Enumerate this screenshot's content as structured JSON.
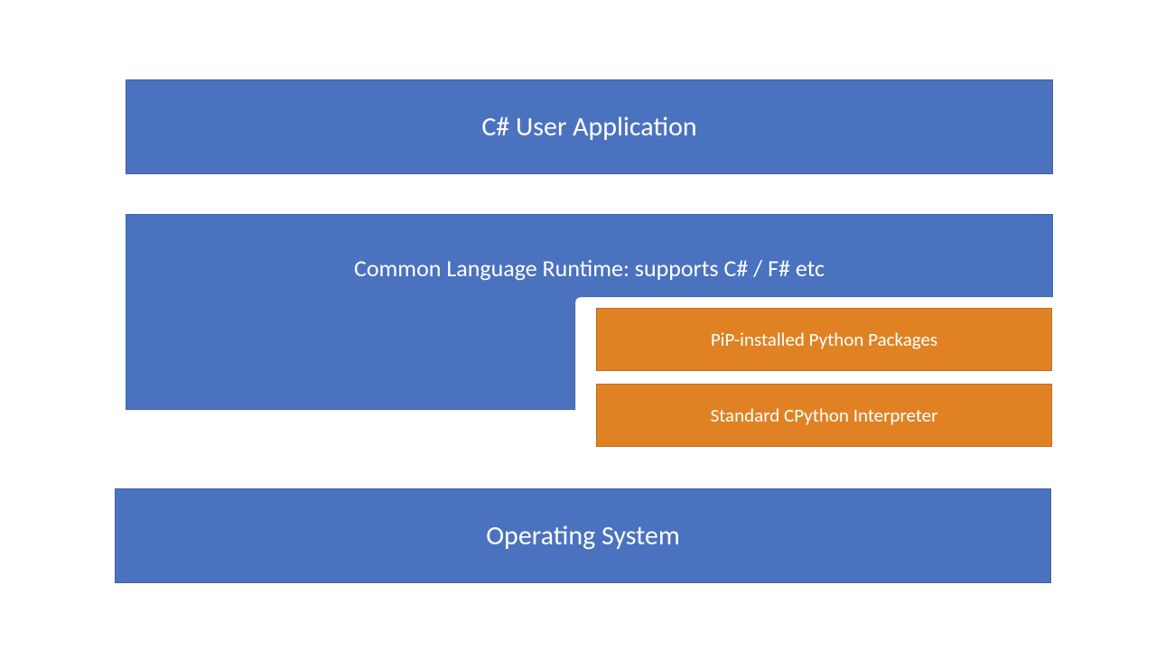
{
  "diagram": {
    "layers": {
      "user_app": {
        "label": "C# User Application",
        "color": "#4a72bf"
      },
      "clr": {
        "label": "Common Language Runtime: supports C# / F# etc",
        "color": "#4a72bf"
      },
      "pip_packages": {
        "label": "PiP-installed Python Packages",
        "color": "#e08224"
      },
      "cpython": {
        "label": "Standard CPython Interpreter",
        "color": "#e08224"
      },
      "os": {
        "label": "Operating System",
        "color": "#4a72bf"
      }
    },
    "colors": {
      "blue": "#4a72bf",
      "orange": "#e08224",
      "text": "#ffffff"
    }
  }
}
